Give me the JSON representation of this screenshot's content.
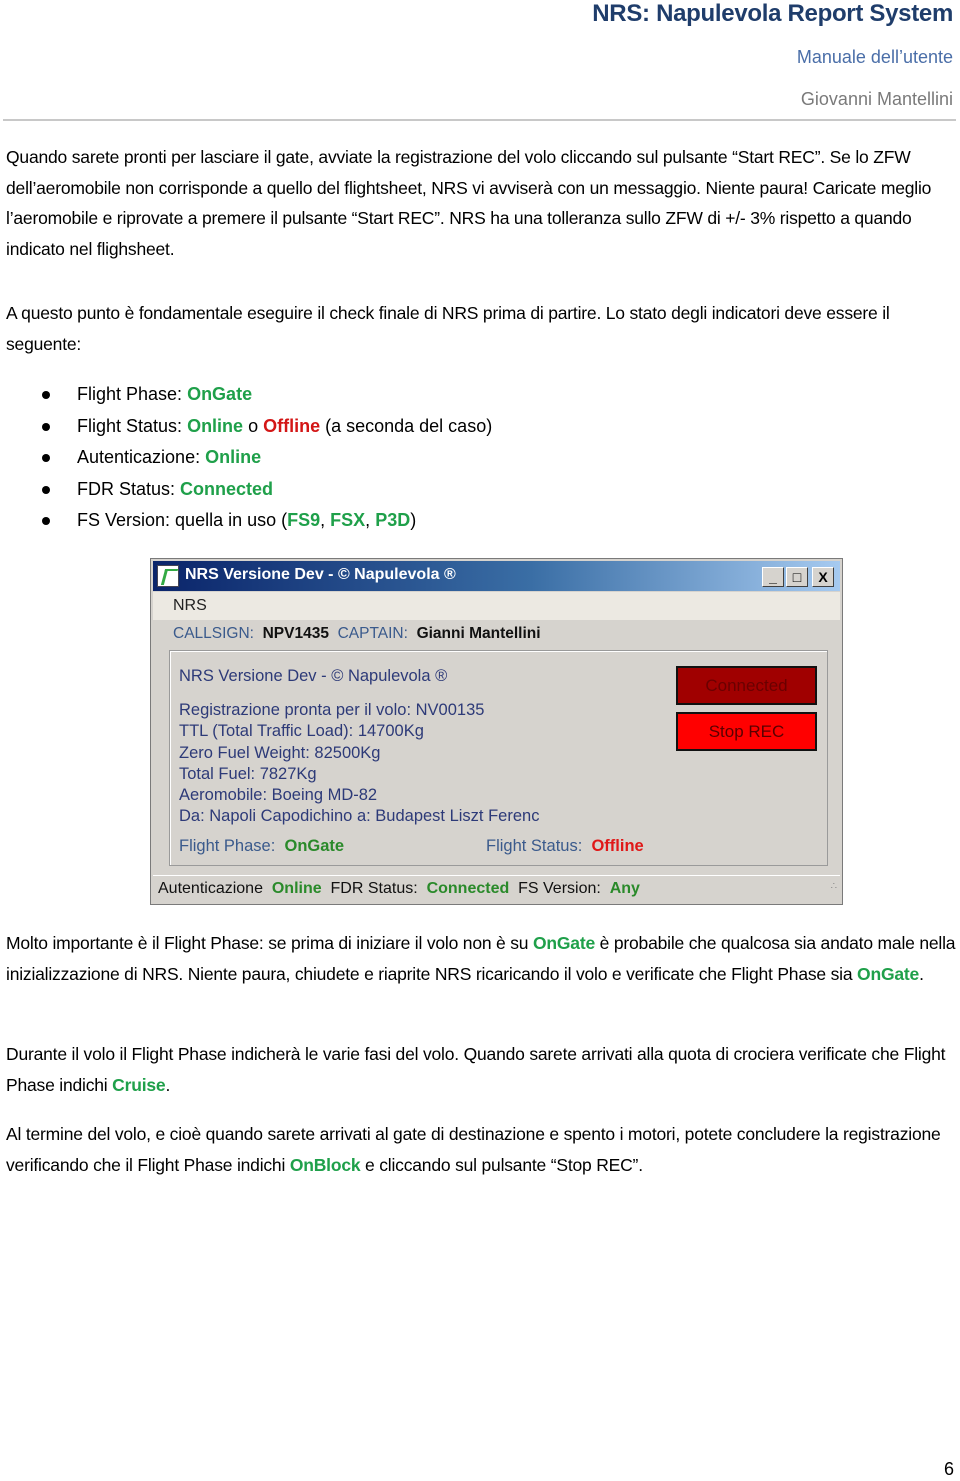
{
  "header": {
    "title": "NRS: Napulevola Report System",
    "subtitle": "Manuale dell’utente",
    "author": "Giovanni Mantellini"
  },
  "intro": {
    "p1": "Quando sarete pronti per lasciare il gate, avviate la registrazione del volo cliccando sul pulsante “Start REC”. Se lo ZFW dell’aeromobile non corrisponde a quello del flightsheet, NRS vi avviserà con un messaggio. Niente paura! Caricate meglio l’aeromobile e riprovate a premere il pulsante “Start REC”. NRS ha una tolleranza sullo ZFW di +/- 3% rispetto a quando indicato nel flighsheet.",
    "p2": "A questo punto è fondamentale eseguire il check finale di NRS prima di partire. Lo stato degli indicatori deve essere il seguente:"
  },
  "checklist": [
    {
      "label": "Flight Phase: ",
      "value": "OnGate"
    },
    {
      "label": "Flight Status: ",
      "value": "Online",
      "mid": " o ",
      "value2": "Offline",
      "suffix": " (a seconda del caso)"
    },
    {
      "label": "Autenticazione: ",
      "value": "Online"
    },
    {
      "label": "FDR Status: ",
      "value": "Connected"
    },
    {
      "label": "FS Version: quella in uso (",
      "versions": [
        "FS9",
        "FSX",
        "P3D"
      ],
      "sep": ", ",
      "suffix": ")"
    }
  ],
  "window": {
    "title": "NRS Versione Dev - © Napulevola ®",
    "min": "_",
    "max": "□",
    "close": "X",
    "menu": "NRS",
    "callsign_label": "CALLSIGN:",
    "callsign": "NPV1435",
    "captain_label": "CAPTAIN:",
    "captain": "Gianni Mantellini",
    "info_title": "NRS Versione Dev - © Napulevola ®",
    "info_lines": [
      "Registrazione pronta per il volo: NV00135",
      "TTL (Total Traffic Load): 14700Kg",
      "Zero Fuel Weight: 82500Kg",
      "Total Fuel: 7827Kg",
      "Aeromobile: Boeing MD-82",
      "Da: Napoli Capodichino a: Budapest Liszt Ferenc"
    ],
    "connected_button": "Connected",
    "stop_button": "Stop REC",
    "flight_phase_label": "Flight Phase:",
    "flight_phase": "OnGate",
    "flight_status_label": "Flight Status:",
    "flight_status": "Offline",
    "status_auth_label": "Autenticazione",
    "status_auth": "Online",
    "status_fdr_label": "FDR Status:",
    "status_fdr": "Connected",
    "status_fs_label": "FS Version:",
    "status_fs": "Any"
  },
  "after": {
    "p3a": "Molto importante è il Flight Phase: se prima di iniziare il volo non è su ",
    "p3_hl1": "OnGate",
    "p3b": " è probabile che qualcosa sia andato male nella inizializzazione di NRS. Niente paura, chiudete e riaprite NRS ricaricando il volo e verificate che Flight Phase sia ",
    "p3_hl2": "OnGate",
    "p3c": ".",
    "p4a": "Durante il volo il Flight Phase indicherà le varie fasi del volo. Quando sarete arrivati alla quota di crociera verificate che Flight Phase indichi ",
    "p4_hl": "Cruise",
    "p4b": ".",
    "p5a": "Al termine del volo, e cioè quando sarete arrivati al gate di destinazione e spento i motori, potete concludere la registrazione verificando che il Flight Phase indichi ",
    "p5_hl": "OnBlock",
    "p5b": " e cliccando sul pulsante “Stop REC”."
  },
  "page_number": "6",
  "colors": {
    "highlight_green": "#1fa04a",
    "highlight_red": "#d31616",
    "header_blue": "#1f3d6b"
  }
}
